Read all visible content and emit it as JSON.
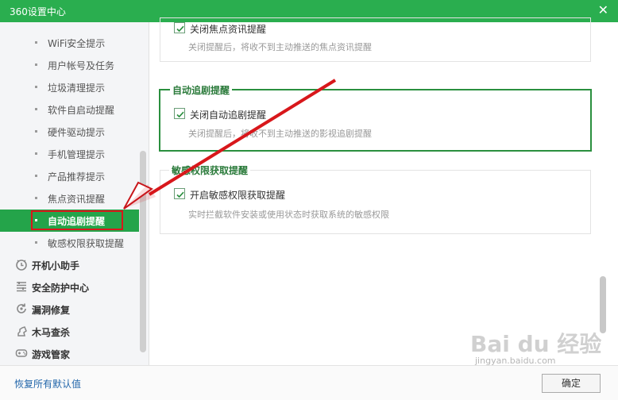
{
  "window": {
    "title": "360设置中心",
    "close_glyph": "✕"
  },
  "sidebar": {
    "sub_items": [
      {
        "label": "WiFi安全提示",
        "active": false
      },
      {
        "label": "用户帐号及任务",
        "active": false
      },
      {
        "label": "垃圾清理提示",
        "active": false
      },
      {
        "label": "软件自启动提醒",
        "active": false
      },
      {
        "label": "硬件驱动提示",
        "active": false
      },
      {
        "label": "手机管理提示",
        "active": false
      },
      {
        "label": "产品推荐提示",
        "active": false
      },
      {
        "label": "焦点资讯提醒",
        "active": false
      },
      {
        "label": "自动追剧提醒",
        "active": true
      },
      {
        "label": "敏感权限获取提醒",
        "active": false
      }
    ],
    "main_items": [
      {
        "label": "开机小助手",
        "icon": "clock-icon"
      },
      {
        "label": "安全防护中心",
        "icon": "list-icon"
      },
      {
        "label": "漏洞修复",
        "icon": "refresh-icon"
      },
      {
        "label": "木马查杀",
        "icon": "horse-icon"
      },
      {
        "label": "游戏管家",
        "icon": "gamepad-icon"
      }
    ]
  },
  "content": {
    "focus_section": {
      "option_label": "关闭焦点资讯提醒",
      "checked": true,
      "description": "关闭提醒后，将收不到主动推送的焦点资讯提醒"
    },
    "drama_section": {
      "legend": "自动追剧提醒",
      "option_label": "关闭自动追剧提醒",
      "checked": true,
      "description": "关闭提醒后，将收不到主动推送的影视追剧提醒"
    },
    "permission_section": {
      "legend": "敏感权限获取提醒",
      "option_label": "开启敏感权限获取提醒",
      "checked": true,
      "description": "实时拦截软件安装或使用状态时获取系统的敏感权限"
    }
  },
  "footer": {
    "restore_label": "恢复所有默认值",
    "ok_label": "确定"
  },
  "watermark": {
    "logo": "Bai du 经验",
    "url": "jingyan.baidu.com"
  },
  "colors": {
    "title_green": "#2aae4f",
    "active_green": "#24a44a",
    "annotation_red": "#d8171b",
    "legend_green": "#2a7a3a"
  }
}
